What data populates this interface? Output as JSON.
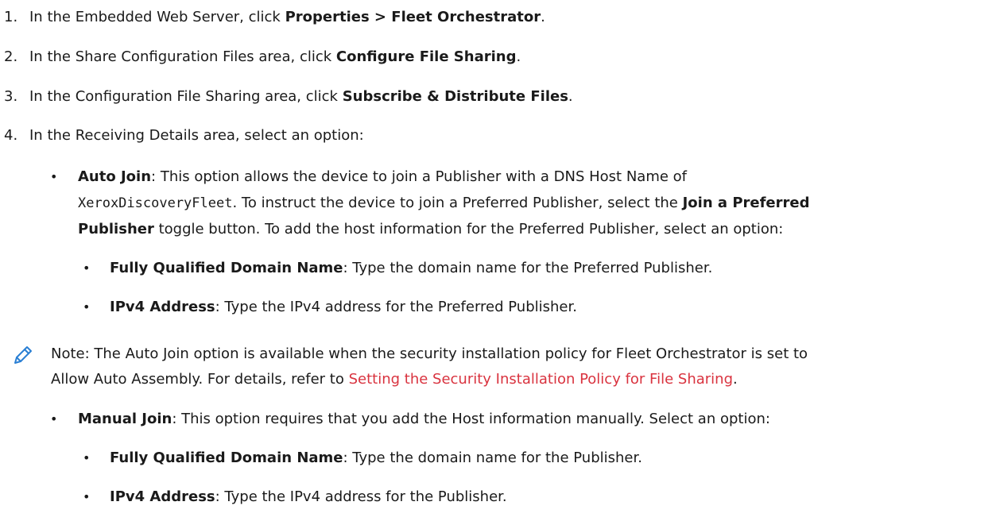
{
  "steps": [
    {
      "num": "1.",
      "pre": "In the Embedded Web Server, click ",
      "bold": "Properties > Fleet Orchestrator",
      "post": "."
    },
    {
      "num": "2.",
      "pre": "In the Share Configuration Files area, click ",
      "bold": "Configure File Sharing",
      "post": "."
    },
    {
      "num": "3.",
      "pre": "In the Configuration File Sharing area, click ",
      "bold": "Subscribe & Distribute Files",
      "post": "."
    },
    {
      "num": "4.",
      "text": "In the Receiving Details area, select an option:"
    }
  ],
  "auto_join": {
    "label": "Auto Join",
    "line1": ": This option allows the device to join a Publisher with a DNS Host Name of",
    "host": "XeroxDiscoveryFleet",
    "line2_mid": ". To instruct the device to join a Preferred Publisher, select the ",
    "toggle_bold_1": "Join a Preferred",
    "toggle_bold_2": "Publisher",
    "line3_rest": " toggle button. To add the host information for the Preferred Publisher, select an option:",
    "sub": [
      {
        "label": "Fully Qualified Domain Name",
        "text": ": Type the domain name for the Preferred Publisher."
      },
      {
        "label": "IPv4 Address",
        "text": ": Type the IPv4 address for the Preferred Publisher."
      }
    ]
  },
  "note": {
    "icon": "pencil-icon",
    "line1": "Note: The Auto Join option is available when the security installation policy for Fleet Orchestrator is set to",
    "line2_pre": "Allow Auto Assembly. For details, refer to ",
    "link": "Setting the Security Installation Policy for File Sharing",
    "line2_post": ".",
    "icon_color": "#2a7fd4",
    "link_color": "#d9333f"
  },
  "manual_join": {
    "label": "Manual Join",
    "text": ": This option requires that you add the Host information manually. Select an option:",
    "sub": [
      {
        "label": "Fully Qualified Domain Name",
        "text": ": Type the domain name for the Publisher."
      },
      {
        "label": "IPv4 Address",
        "text": ": Type the IPv4 address for the Publisher."
      }
    ]
  },
  "bullet_char": "•"
}
